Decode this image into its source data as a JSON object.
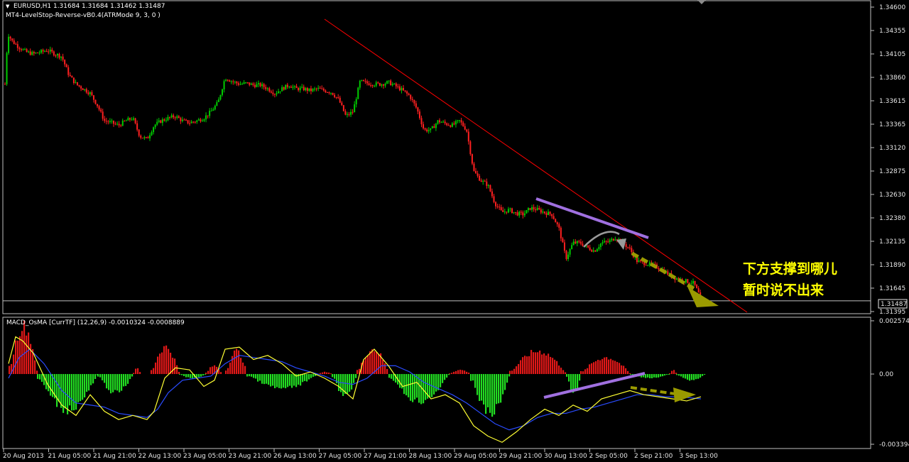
{
  "window": {
    "dropdown_glyph": "▼",
    "main_title": "EURUSD,H1  1.31684 1.31684 1.31462 1.31487",
    "indicator1": "MT4-LevelStop-Reverse-vB0.4(ATRMode 9, 3, 0 )"
  },
  "price_axis": {
    "ticks": [
      "1.34600",
      "1.34355",
      "1.34105",
      "1.33860",
      "1.33615",
      "1.33365",
      "1.33120",
      "1.32875",
      "1.32630",
      "1.32380",
      "1.32135",
      "1.31890",
      "1.31645",
      "1.31395"
    ],
    "current_price": "1.31487"
  },
  "macd_panel": {
    "title": "MACD_OsMA [CurrTF] (12,26,9) -0.0010324 -0.0008889",
    "ticks": [
      "0.0025740",
      "0.00",
      "-0.0033945"
    ]
  },
  "time_axis": {
    "labels": [
      "20 Aug 2013",
      "21 Aug 05:00",
      "21 Aug 21:00",
      "22 Aug 13:00",
      "23 Aug 05:00",
      "23 Aug 21:00",
      "26 Aug 13:00",
      "27 Aug 05:00",
      "27 Aug 21:00",
      "28 Aug 13:00",
      "29 Aug 05:00",
      "29 Aug 21:00",
      "30 Aug 13:00",
      "2 Sep 05:00",
      "2 Sep 21:00",
      "3 Sep 13:00"
    ]
  },
  "annotation": {
    "line1": "下方支撑到哪儿",
    "line2": "暂时说不出来"
  },
  "colors": {
    "bull": "#00cc00",
    "bear": "#ff2020",
    "hist_up": "#e01818",
    "hist_down": "#22dd22",
    "macd_line": "#ffff33",
    "signal_line": "#2a4cff",
    "trend_line": "#ff0000",
    "purple": "#a070e0",
    "olive": "#9a9a00",
    "gray_arrow": "#9a9a9a",
    "annotation_text": "#ffff00"
  },
  "chart_data": {
    "type": "candlestick",
    "symbol": "EURUSD",
    "timeframe": "H1",
    "ylim": [
      1.3137,
      1.3469
    ],
    "close_path": [
      [
        0,
        1.3385
      ],
      [
        4,
        1.344
      ],
      [
        10,
        1.3432
      ],
      [
        20,
        1.3425
      ],
      [
        30,
        1.342
      ],
      [
        40,
        1.3418
      ],
      [
        50,
        1.342
      ],
      [
        60,
        1.3422
      ],
      [
        70,
        1.3418
      ],
      [
        80,
        1.3415
      ],
      [
        90,
        1.3395
      ],
      [
        100,
        1.3385
      ],
      [
        110,
        1.338
      ],
      [
        120,
        1.3375
      ],
      [
        130,
        1.3362
      ],
      [
        140,
        1.3345
      ],
      [
        150,
        1.3343
      ],
      [
        160,
        1.334
      ],
      [
        170,
        1.3345
      ],
      [
        180,
        1.3348
      ],
      [
        190,
        1.3328
      ],
      [
        200,
        1.3325
      ],
      [
        210,
        1.334
      ],
      [
        220,
        1.3345
      ],
      [
        230,
        1.3348
      ],
      [
        240,
        1.335
      ],
      [
        250,
        1.3345
      ],
      [
        260,
        1.3343
      ],
      [
        270,
        1.3345
      ],
      [
        280,
        1.3348
      ],
      [
        290,
        1.3355
      ],
      [
        300,
        1.3365
      ],
      [
        310,
        1.3392
      ],
      [
        320,
        1.3388
      ],
      [
        330,
        1.3385
      ],
      [
        340,
        1.3386
      ],
      [
        350,
        1.3384
      ],
      [
        360,
        1.3384
      ],
      [
        370,
        1.338
      ],
      [
        380,
        1.3375
      ],
      [
        390,
        1.338
      ],
      [
        400,
        1.3384
      ],
      [
        410,
        1.338
      ],
      [
        420,
        1.338
      ],
      [
        430,
        1.3378
      ],
      [
        440,
        1.338
      ],
      [
        450,
        1.3378
      ],
      [
        460,
        1.3376
      ],
      [
        470,
        1.3368
      ],
      [
        480,
        1.335
      ],
      [
        490,
        1.3355
      ],
      [
        500,
        1.3388
      ],
      [
        510,
        1.3386
      ],
      [
        520,
        1.3385
      ],
      [
        530,
        1.3385
      ],
      [
        540,
        1.3387
      ],
      [
        550,
        1.3383
      ],
      [
        560,
        1.3378
      ],
      [
        570,
        1.3372
      ],
      [
        580,
        1.3358
      ],
      [
        590,
        1.3335
      ],
      [
        600,
        1.3335
      ],
      [
        610,
        1.3345
      ],
      [
        620,
        1.3342
      ],
      [
        630,
        1.334
      ],
      [
        640,
        1.3345
      ],
      [
        650,
        1.3335
      ],
      [
        660,
        1.329
      ],
      [
        670,
        1.328
      ],
      [
        680,
        1.3275
      ],
      [
        690,
        1.3255
      ],
      [
        700,
        1.3245
      ],
      [
        710,
        1.3248
      ],
      [
        720,
        1.3244
      ],
      [
        730,
        1.3243
      ],
      [
        740,
        1.325
      ],
      [
        750,
        1.3248
      ],
      [
        760,
        1.3245
      ],
      [
        770,
        1.3243
      ],
      [
        780,
        1.3228
      ],
      [
        790,
        1.3195
      ],
      [
        800,
        1.3212
      ],
      [
        810,
        1.3212
      ],
      [
        820,
        1.3207
      ],
      [
        830,
        1.3203
      ],
      [
        840,
        1.3212
      ],
      [
        850,
        1.3213
      ],
      [
        860,
        1.3218
      ],
      [
        870,
        1.3212
      ],
      [
        880,
        1.3205
      ],
      [
        890,
        1.3192
      ],
      [
        900,
        1.319
      ],
      [
        910,
        1.3188
      ],
      [
        920,
        1.3185
      ],
      [
        930,
        1.318
      ],
      [
        940,
        1.3175
      ],
      [
        950,
        1.3172
      ],
      [
        960,
        1.317
      ],
      [
        970,
        1.3168
      ],
      [
        980,
        1.3151
      ]
    ],
    "trendline": [
      [
        457,
        27
      ],
      [
        1052,
        440
      ]
    ],
    "current_price": 1.31487,
    "macd_ylim": [
      -0.0033945,
      0.002574
    ],
    "histogram_up_blocks": [
      [
        5,
        45,
        0.0023
      ],
      [
        180,
        190,
        0.0003
      ],
      [
        205,
        245,
        0.0013
      ],
      [
        282,
        305,
        0.0004
      ],
      [
        310,
        340,
        0.0011
      ],
      [
        440,
        460,
        0.0001
      ],
      [
        495,
        540,
        0.0012
      ],
      [
        625,
        655,
        0.0002
      ],
      [
        710,
        790,
        0.0011
      ],
      [
        810,
        880,
        0.0008
      ],
      [
        935,
        945,
        0.0002
      ]
    ],
    "histogram_down_blocks": [
      [
        45,
        130,
        -0.0017
      ],
      [
        130,
        180,
        -0.0009
      ],
      [
        245,
        282,
        -0.0002
      ],
      [
        340,
        440,
        -0.0007
      ],
      [
        460,
        495,
        -0.001
      ],
      [
        540,
        625,
        -0.0013
      ],
      [
        655,
        710,
        -0.0019
      ],
      [
        790,
        810,
        -0.0009
      ],
      [
        880,
        935,
        -0.0002
      ],
      [
        945,
        985,
        -0.0003
      ]
    ],
    "macd_line": [
      [
        5,
        0.0005
      ],
      [
        15,
        0.0018
      ],
      [
        25,
        0.0016
      ],
      [
        40,
        0.001
      ],
      [
        60,
        -0.0005
      ],
      [
        80,
        -0.0015
      ],
      [
        100,
        -0.002
      ],
      [
        120,
        -0.001
      ],
      [
        140,
        -0.0018
      ],
      [
        160,
        -0.0022
      ],
      [
        180,
        -0.002
      ],
      [
        200,
        -0.0022
      ],
      [
        210,
        -0.0018
      ],
      [
        225,
        -0.0002
      ],
      [
        240,
        0.0003
      ],
      [
        260,
        0.0002
      ],
      [
        280,
        -0.0006
      ],
      [
        295,
        -0.0003
      ],
      [
        310,
        0.0012
      ],
      [
        330,
        0.0013
      ],
      [
        350,
        0.0007
      ],
      [
        370,
        0.0009
      ],
      [
        390,
        0.0005
      ],
      [
        410,
        -0.0001
      ],
      [
        430,
        0.0001
      ],
      [
        450,
        -0.0002
      ],
      [
        470,
        -0.0006
      ],
      [
        490,
        -0.0012
      ],
      [
        505,
        0.0007
      ],
      [
        520,
        0.0012
      ],
      [
        540,
        0.0004
      ],
      [
        560,
        -0.0006
      ],
      [
        580,
        -0.0004
      ],
      [
        600,
        -0.0012
      ],
      [
        620,
        -0.001
      ],
      [
        640,
        -0.0014
      ],
      [
        660,
        -0.0025
      ],
      [
        680,
        -0.003
      ],
      [
        700,
        -0.0033
      ],
      [
        720,
        -0.0028
      ],
      [
        740,
        -0.0022
      ],
      [
        760,
        -0.0017
      ],
      [
        780,
        -0.002
      ],
      [
        800,
        -0.0015
      ],
      [
        820,
        -0.0018
      ],
      [
        840,
        -0.0012
      ],
      [
        860,
        -0.001
      ],
      [
        880,
        -0.0008
      ],
      [
        900,
        -0.001
      ],
      [
        920,
        -0.0011
      ],
      [
        940,
        -0.0012
      ],
      [
        960,
        -0.0013
      ],
      [
        980,
        -0.0011
      ]
    ],
    "signal_line": [
      [
        5,
        -0.0002
      ],
      [
        20,
        0.0008
      ],
      [
        35,
        0.0012
      ],
      [
        55,
        0.0005
      ],
      [
        80,
        -0.0008
      ],
      [
        100,
        -0.0014
      ],
      [
        120,
        -0.0015
      ],
      [
        140,
        -0.0016
      ],
      [
        160,
        -0.0019
      ],
      [
        180,
        -0.002
      ],
      [
        200,
        -0.0021
      ],
      [
        215,
        -0.0017
      ],
      [
        230,
        -0.0009
      ],
      [
        250,
        -0.0003
      ],
      [
        270,
        -0.0002
      ],
      [
        290,
        -0.0001
      ],
      [
        310,
        0.0005
      ],
      [
        330,
        0.0009
      ],
      [
        350,
        0.0008
      ],
      [
        370,
        0.0007
      ],
      [
        390,
        0.0006
      ],
      [
        410,
        0.0003
      ],
      [
        430,
        0.0001
      ],
      [
        450,
        -0.0001
      ],
      [
        470,
        -0.0004
      ],
      [
        490,
        -0.0005
      ],
      [
        510,
        -0.0002
      ],
      [
        530,
        0.0004
      ],
      [
        550,
        0.0004
      ],
      [
        570,
        0.0001
      ],
      [
        590,
        -0.0004
      ],
      [
        610,
        -0.0007
      ],
      [
        630,
        -0.001
      ],
      [
        650,
        -0.0014
      ],
      [
        670,
        -0.0019
      ],
      [
        690,
        -0.0024
      ],
      [
        710,
        -0.0027
      ],
      [
        730,
        -0.0025
      ],
      [
        750,
        -0.0021
      ],
      [
        770,
        -0.0019
      ],
      [
        790,
        -0.0019
      ],
      [
        810,
        -0.0017
      ],
      [
        830,
        -0.0016
      ],
      [
        850,
        -0.0014
      ],
      [
        870,
        -0.0012
      ],
      [
        890,
        -0.001
      ],
      [
        910,
        -0.001
      ],
      [
        930,
        -0.0011
      ],
      [
        950,
        -0.0011
      ],
      [
        980,
        -0.0012
      ]
    ]
  }
}
